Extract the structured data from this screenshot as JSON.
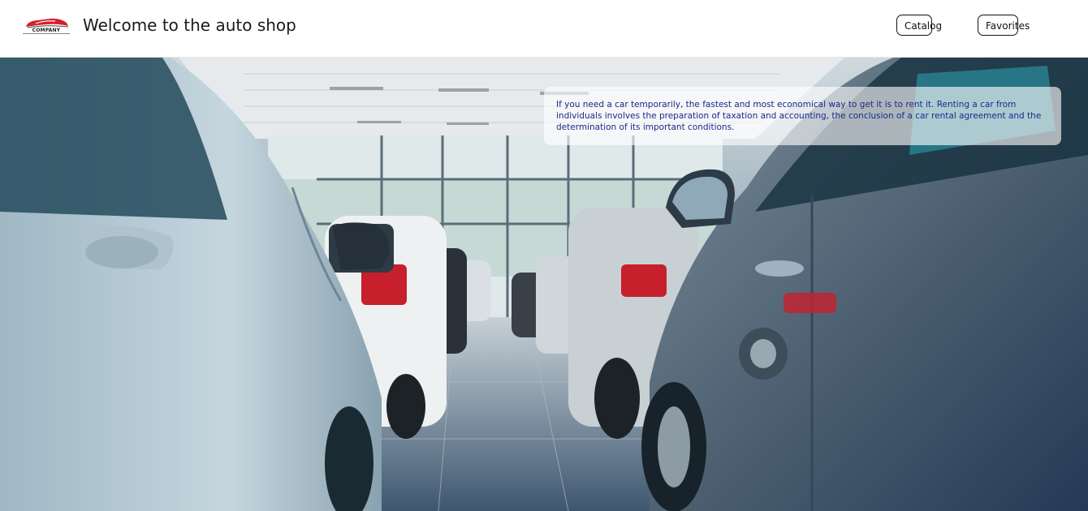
{
  "header": {
    "logo_text": "COMPANY",
    "title": "Welcome to the auto shop",
    "nav": {
      "catalog_label": "Catalog",
      "favorites_label": "Favorites"
    }
  },
  "hero": {
    "image_alt": "showroom-with-parked-cars",
    "info_text": "If you need a car temporarily, the fastest and most economical way to get it is to rent it. Renting a car from individuals involves the preparation of taxation and accounting, the conclusion of a car rental agreement and the determination of its important conditions."
  },
  "colors": {
    "brand_red": "#d81f2a",
    "info_text": "#1b2a8a",
    "hero_dark": "#2d4866"
  }
}
